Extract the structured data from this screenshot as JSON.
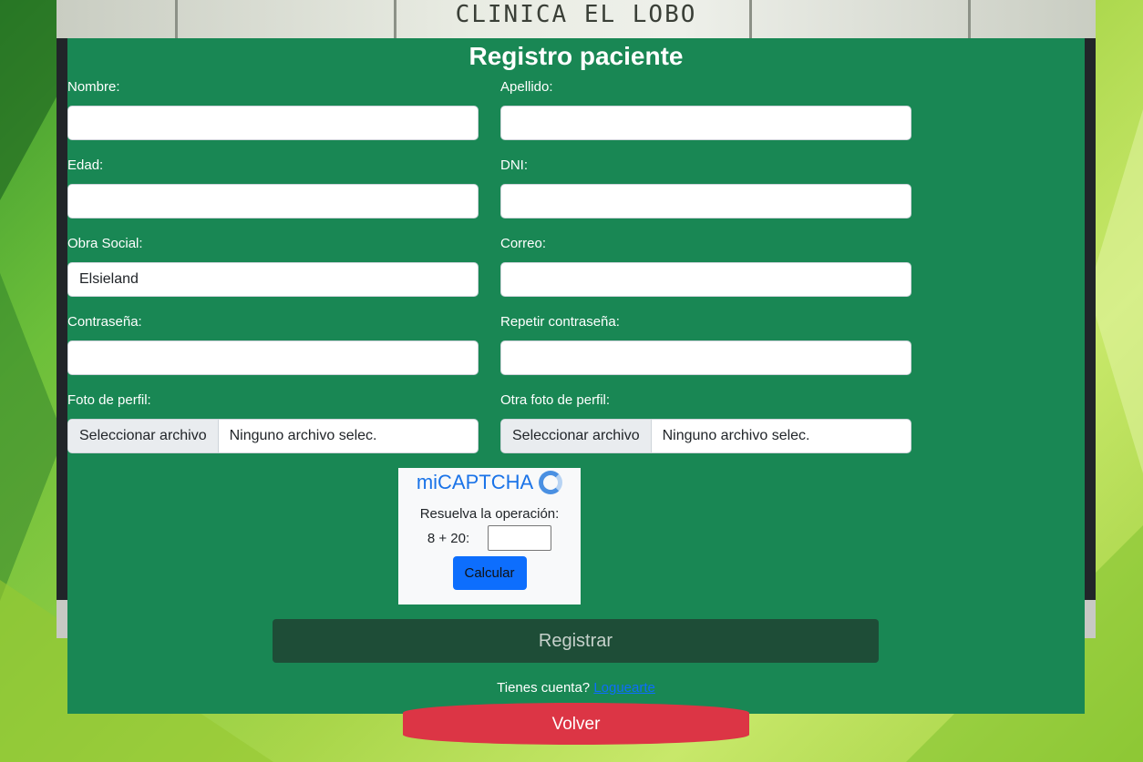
{
  "brand": "CLINICA EL LOBO",
  "form": {
    "title": "Registro paciente",
    "fields": {
      "nombre": {
        "label": "Nombre:",
        "value": ""
      },
      "apellido": {
        "label": "Apellido:",
        "value": ""
      },
      "edad": {
        "label": "Edad:",
        "value": ""
      },
      "dni": {
        "label": "DNI:",
        "value": ""
      },
      "obra_social": {
        "label": "Obra Social:",
        "value": "Elsieland"
      },
      "correo": {
        "label": "Correo:",
        "value": ""
      },
      "contrasena": {
        "label": "Contraseña:",
        "value": ""
      },
      "repetir": {
        "label": "Repetir contraseña:",
        "value": ""
      }
    },
    "foto": {
      "label": "Foto de perfil:",
      "button": "Seleccionar archivo",
      "status": "Ninguno archivo selec."
    },
    "otra_foto": {
      "label": "Otra foto de perfil:",
      "button": "Seleccionar archivo",
      "status": "Ninguno archivo selec."
    }
  },
  "captcha": {
    "title": "miCAPTCHA",
    "prompt": "Resuelva la operación:",
    "operation": "8 + 20:",
    "answer": "",
    "button": "Calcular"
  },
  "actions": {
    "register": "Registrar",
    "account_text": "Tienes cuenta?",
    "login_link": "Loguearte",
    "back": "Volver"
  },
  "colors": {
    "card": "#198754",
    "register": "#1e4d37",
    "back": "#dc3545",
    "captcha_button": "#0d6efd"
  }
}
